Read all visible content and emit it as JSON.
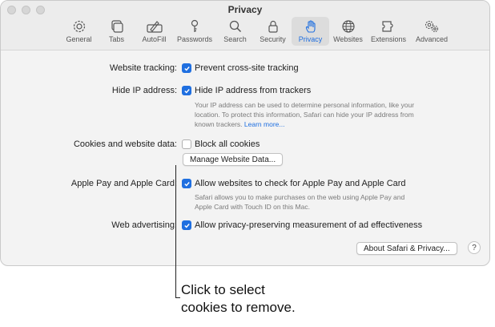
{
  "window": {
    "title": "Privacy"
  },
  "toolbar": {
    "tabs": [
      {
        "label": "General",
        "icon": "gear-icon"
      },
      {
        "label": "Tabs",
        "icon": "tabs-icon"
      },
      {
        "label": "AutoFill",
        "icon": "autofill-icon"
      },
      {
        "label": "Passwords",
        "icon": "key-icon"
      },
      {
        "label": "Search",
        "icon": "search-icon"
      },
      {
        "label": "Security",
        "icon": "lock-icon"
      },
      {
        "label": "Privacy",
        "icon": "hand-icon",
        "active": true
      },
      {
        "label": "Websites",
        "icon": "globe-icon"
      },
      {
        "label": "Extensions",
        "icon": "puzzle-icon"
      },
      {
        "label": "Advanced",
        "icon": "gears-icon"
      }
    ]
  },
  "settings": {
    "tracking": {
      "label": "Website tracking:",
      "option": "Prevent cross-site tracking",
      "checked": true
    },
    "ip": {
      "label": "Hide IP address:",
      "option": "Hide IP address from trackers",
      "checked": true,
      "note": "Your IP address can be used to determine personal information, like your location. To protect this information, Safari can hide your IP address from known trackers.",
      "link": "Learn more..."
    },
    "cookies": {
      "label": "Cookies and website data:",
      "option": "Block all cookies",
      "checked": false,
      "button": "Manage Website Data..."
    },
    "applepay": {
      "label": "Apple Pay and Apple Card:",
      "option": "Allow websites to check for Apple Pay and Apple Card",
      "checked": true,
      "note": "Safari allows you to make purchases on the web using Apple Pay and Apple Card with Touch ID on this Mac."
    },
    "advertising": {
      "label": "Web advertising:",
      "option": "Allow privacy-preserving measurement of ad effectiveness",
      "checked": true
    },
    "about_button": "About Safari & Privacy...",
    "help_button": "?"
  },
  "callout": {
    "line1": "Click to select",
    "line2": "cookies to remove."
  },
  "colors": {
    "accent": "#1f6fe0",
    "window_bg": "#f3f3f3"
  }
}
